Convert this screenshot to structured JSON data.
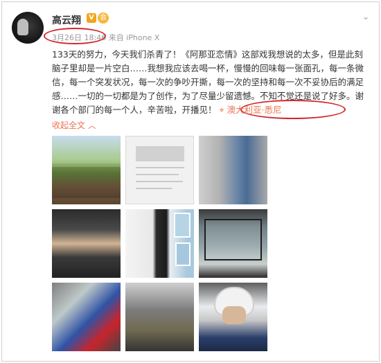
{
  "post": {
    "author": "高云翔",
    "verified_badge": "V",
    "member_badge": "会",
    "date": "3月26日 18:46",
    "source": "来自 iPhone X",
    "text": "133天的努力，今天我们杀青了！《阿那亚恋情》这部戏我想说的太多，但是此刻脑子里却是一片空白……我想我应该去喝一杯，慢慢的回味每一张面孔，每一条微信，每一个突发状况，每一次的争吵开撕，每一次的坚持和每一次不妥协后的满足感……一切的一切都是为了创作，为了尽量少留遗憾。不知不觉还是说了好多。谢谢各个部门的每一个人，辛苦啦，开播见！",
    "location": "澳大利亚·悉尼",
    "collapse_label": "收起全文",
    "collapse_icon": "chevron-up",
    "menu_icon": "chevron-down",
    "accent_color": "#eb7350",
    "annotation_color": "#d4252b"
  },
  "images": [
    {
      "name": "group-photo-outdoors"
    },
    {
      "name": "document-photo"
    },
    {
      "name": "two-people-photo"
    },
    {
      "name": "portrait-photo"
    },
    {
      "name": "suit-standing-photo"
    },
    {
      "name": "monitor-photo"
    },
    {
      "name": "superman-costume-photo"
    },
    {
      "name": "set-crowd-photo"
    },
    {
      "name": "helmet-selfie-photo"
    }
  ]
}
